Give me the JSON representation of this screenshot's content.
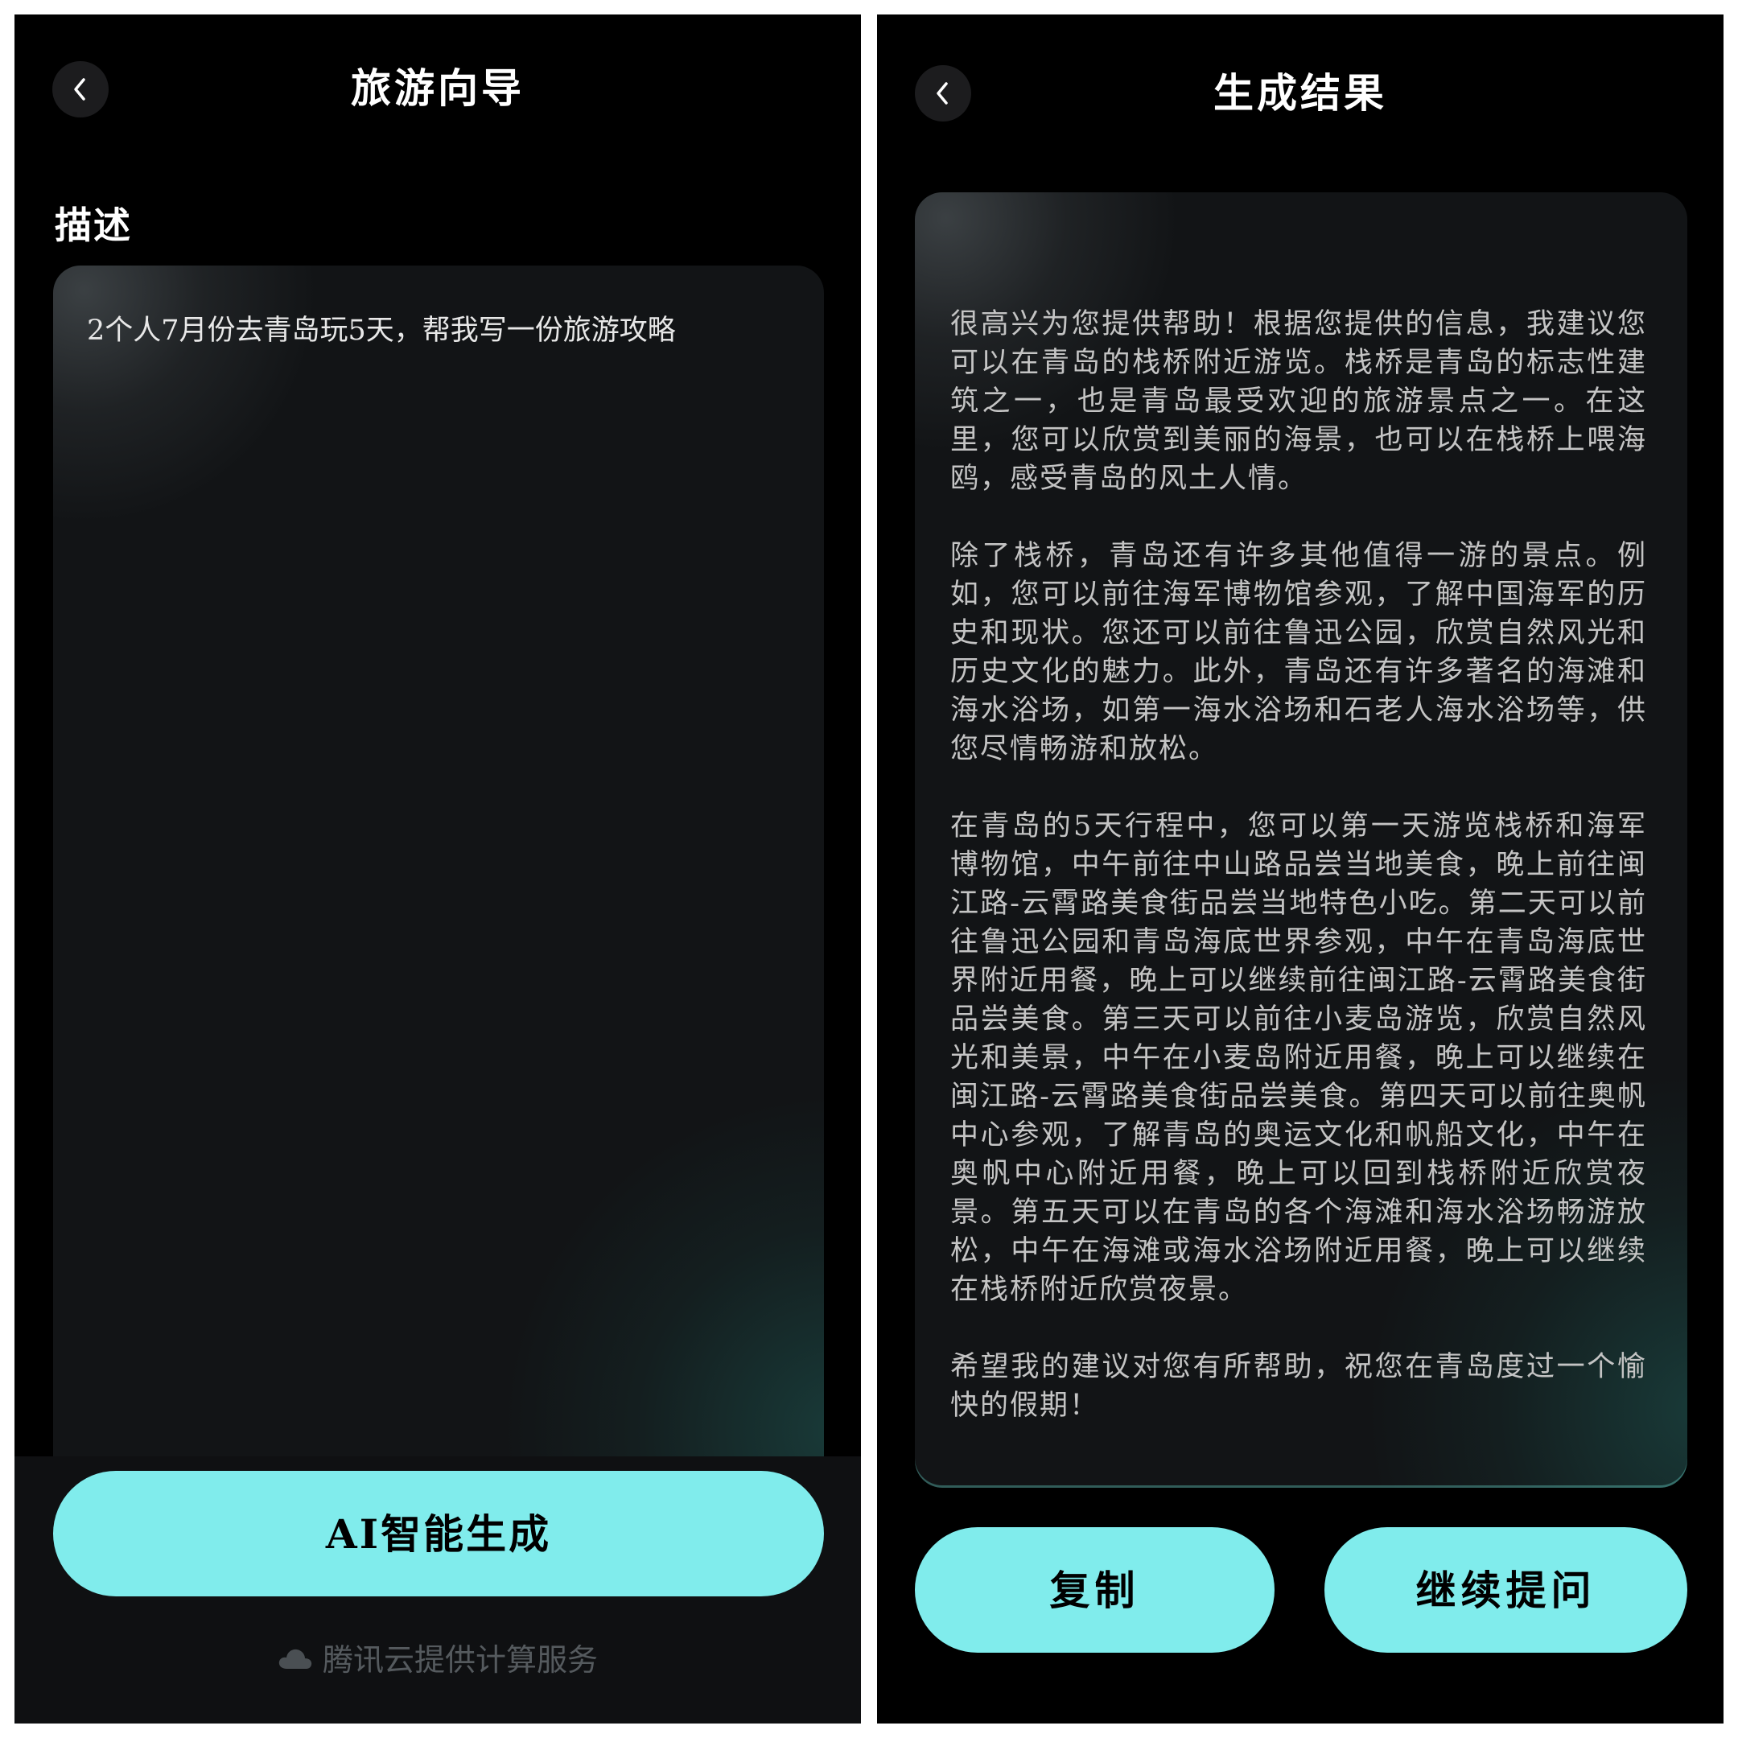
{
  "left_screen": {
    "title": "旅游向导",
    "section_label": "描述",
    "description_value": "2个人7月份去青岛玩5天，帮我写一份旅游攻略",
    "generate_button": "AI智能生成",
    "footer_note": "腾讯云提供计算服务",
    "icons": {
      "back": "chevron-left-icon",
      "footer": "cloud-icon"
    }
  },
  "right_screen": {
    "title": "生成结果",
    "result_paragraphs": [
      "很高兴为您提供帮助！根据您提供的信息，我建议您可以在青岛的栈桥附近游览。栈桥是青岛的标志性建筑之一，也是青岛最受欢迎的旅游景点之一。在这里，您可以欣赏到美丽的海景，也可以在栈桥上喂海鸥，感受青岛的风土人情。",
      "除了栈桥，青岛还有许多其他值得一游的景点。例如，您可以前往海军博物馆参观，了解中国海军的历史和现状。您还可以前往鲁迅公园，欣赏自然风光和历史文化的魅力。此外，青岛还有许多著名的海滩和海水浴场，如第一海水浴场和石老人海水浴场等，供您尽情畅游和放松。",
      "在青岛的5天行程中，您可以第一天游览栈桥和海军博物馆，中午前往中山路品尝当地美食，晚上前往闽江路-云霄路美食街品尝当地特色小吃。第二天可以前往鲁迅公园和青岛海底世界参观，中午在青岛海底世界附近用餐，晚上可以继续前往闽江路-云霄路美食街品尝美食。第三天可以前往小麦岛游览，欣赏自然风光和美景，中午在小麦岛附近用餐，晚上可以继续在闽江路-云霄路美食街品尝美食。第四天可以前往奥帆中心参观，了解青岛的奥运文化和帆船文化，中午在奥帆中心附近用餐，晚上可以回到栈桥附近欣赏夜景。第五天可以在青岛的各个海滩和海水浴场畅游放松，中午在海滩或海水浴场附近用餐，晚上可以继续在栈桥附近欣赏夜景。",
      "希望我的建议对您有所帮助，祝您在青岛度过一个愉快的假期！"
    ],
    "copy_button": "复制",
    "continue_button": "继续提问",
    "icons": {
      "back": "chevron-left-icon"
    }
  },
  "colors": {
    "background": "#000000",
    "accent_button": "#80ecec",
    "card": "#121416",
    "card_glow": "#1e5a55"
  }
}
